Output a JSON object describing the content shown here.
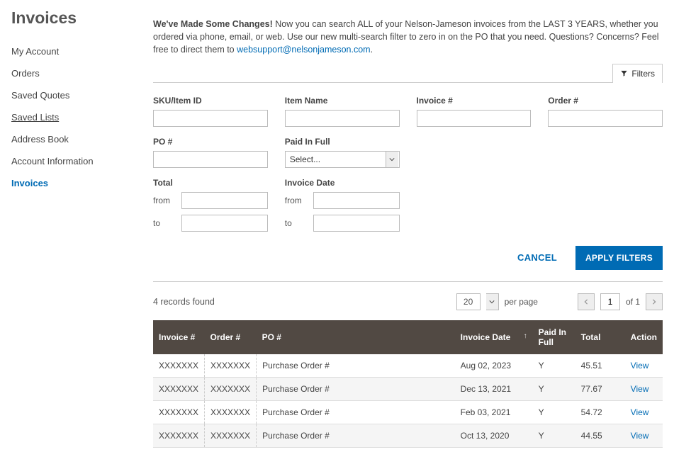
{
  "page": {
    "title": "Invoices"
  },
  "sidebar": {
    "items": [
      {
        "label": "My Account",
        "active": false,
        "underline": false
      },
      {
        "label": "Orders",
        "active": false,
        "underline": false
      },
      {
        "label": "Saved Quotes",
        "active": false,
        "underline": false
      },
      {
        "label": "Saved Lists",
        "active": false,
        "underline": true
      },
      {
        "label": "Address Book",
        "active": false,
        "underline": false
      },
      {
        "label": "Account Information",
        "active": false,
        "underline": false
      },
      {
        "label": "Invoices",
        "active": true,
        "underline": false
      }
    ]
  },
  "intro": {
    "bold": "We've Made Some Changes!",
    "text": " Now you can search ALL of your Nelson-Jameson invoices from the LAST 3 YEARS, whether you ordered via phone, email, or web. Use our new multi-search filter to zero in on the PO that you need. Questions? Concerns? Feel free to direct them to ",
    "link_text": "websupport@nelsonjameson.com",
    "suffix": "."
  },
  "filter_button": "Filters",
  "filters": {
    "sku": {
      "label": "SKU/Item ID",
      "value": ""
    },
    "item_name": {
      "label": "Item Name",
      "value": ""
    },
    "invoice_no": {
      "label": "Invoice #",
      "value": ""
    },
    "order_no": {
      "label": "Order #",
      "value": ""
    },
    "po_no": {
      "label": "PO #",
      "value": ""
    },
    "paid_in_full": {
      "label": "Paid In Full",
      "selected": "Select..."
    },
    "total": {
      "label": "Total",
      "from_label": "from",
      "to_label": "to",
      "from": "",
      "to": ""
    },
    "invoice_date": {
      "label": "Invoice Date",
      "from_label": "from",
      "to_label": "to",
      "from": "",
      "to": ""
    }
  },
  "actions": {
    "cancel": "CANCEL",
    "apply": "APPLY FILTERS"
  },
  "toolbar": {
    "records_found": "4 records found",
    "per_page_value": "20",
    "per_page_label": "per page",
    "page_value": "1",
    "of_label": "of 1"
  },
  "table": {
    "headers": {
      "invoice": "Invoice #",
      "order": "Order #",
      "po": "PO #",
      "date": "Invoice Date",
      "paid": "Paid In Full",
      "total": "Total",
      "action": "Action"
    },
    "sort_indicator": "↑",
    "rows": [
      {
        "invoice": "XXXXXXX",
        "order": "XXXXXXX",
        "po": "Purchase Order #",
        "date": "Aug 02, 2023",
        "paid": "Y",
        "total": "45.51",
        "action": "View"
      },
      {
        "invoice": "XXXXXXX",
        "order": "XXXXXXX",
        "po": "Purchase Order #",
        "date": "Dec 13, 2021",
        "paid": "Y",
        "total": "77.67",
        "action": "View"
      },
      {
        "invoice": "XXXXXXX",
        "order": "XXXXXXX",
        "po": "Purchase Order #",
        "date": "Feb 03, 2021",
        "paid": "Y",
        "total": "54.72",
        "action": "View"
      },
      {
        "invoice": "XXXXXXX",
        "order": "XXXXXXX",
        "po": "Purchase Order #",
        "date": "Oct 13, 2020",
        "paid": "Y",
        "total": "44.55",
        "action": "View"
      }
    ]
  }
}
